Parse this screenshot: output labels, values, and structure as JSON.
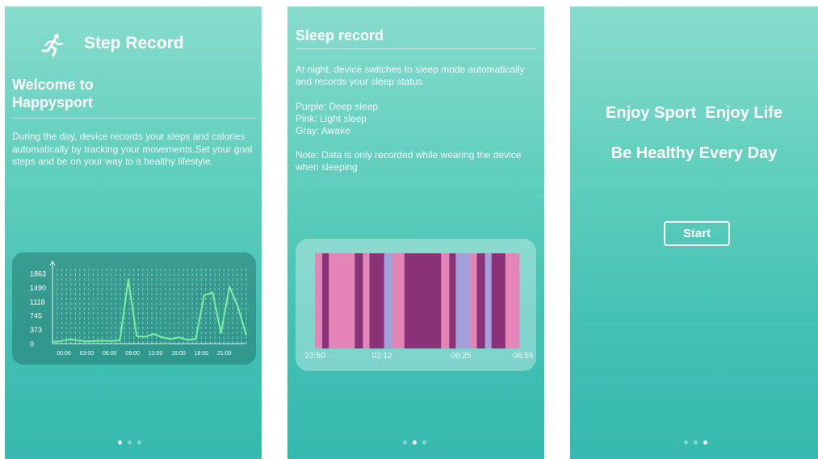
{
  "screens": [
    {
      "title": "Step Record",
      "icon": "running-person-icon",
      "welcome": "Welcome to\nHappysport",
      "body": "During the day, device records your steps and calories automatically by tracking your movements.Set your goal steps and be on your way to a healthy lifestyle.",
      "page_index": 0
    },
    {
      "title": "Sleep record",
      "intro": "At night, device switches to sleep mode automatically and records your sleep status",
      "legend": [
        "Purple: Deep sleep",
        "Pink: Light sleep",
        "Gray: Awake"
      ],
      "note": "Note: Data is only recorded while wearing the device when sleeping",
      "page_index": 1
    },
    {
      "line1": "Enjoy Sport  Enjoy Life",
      "line2": "Be Healthy Every Day",
      "start_label": "Start",
      "page_index": 2
    }
  ],
  "page_count": 3,
  "colors": {
    "deep_sleep": "#8a3278",
    "light_sleep": "#e385b6",
    "awake": "#a3a1dc",
    "step_line": "#7df0a0"
  },
  "chart_data": [
    {
      "type": "line",
      "title": "",
      "xlabel": "",
      "ylabel": "",
      "y_ticks": [
        "1863",
        "1490",
        "1118",
        "745",
        "373",
        "0"
      ],
      "x_ticks": [
        "00:00",
        "03:00",
        "06:00",
        "09:00",
        "12:00",
        "15:00",
        "18:00",
        "21:00"
      ],
      "ylim": [
        0,
        1863
      ],
      "xlim": [
        0,
        23
      ],
      "grid": "vertical dashed",
      "series": [
        {
          "x": [
            0,
            1,
            2,
            3,
            4,
            5,
            6,
            7,
            8,
            9,
            10,
            11,
            12,
            13,
            14,
            15,
            16,
            17,
            18,
            19,
            20,
            21,
            22,
            23
          ],
          "values": [
            50,
            70,
            110,
            90,
            60,
            70,
            80,
            70,
            90,
            1700,
            200,
            180,
            260,
            170,
            120,
            170,
            100,
            120,
            1280,
            1360,
            280,
            1510,
            980,
            220
          ]
        }
      ]
    },
    {
      "type": "bar",
      "title": "",
      "x_ticks": [
        "23:50",
        "03:12",
        "06:25",
        "06:55"
      ],
      "segment_types": [
        "light",
        "deep",
        "light",
        "deep",
        "light",
        "deep",
        "awake",
        "light",
        "deep",
        "deep",
        "light",
        "deep",
        "awake",
        "light",
        "deep",
        "awake",
        "deep",
        "light"
      ],
      "segment_widths": [
        9,
        8,
        32,
        10,
        8,
        18,
        10,
        15,
        20,
        25,
        10,
        8,
        18,
        8,
        10,
        8,
        17,
        17
      ]
    }
  ]
}
